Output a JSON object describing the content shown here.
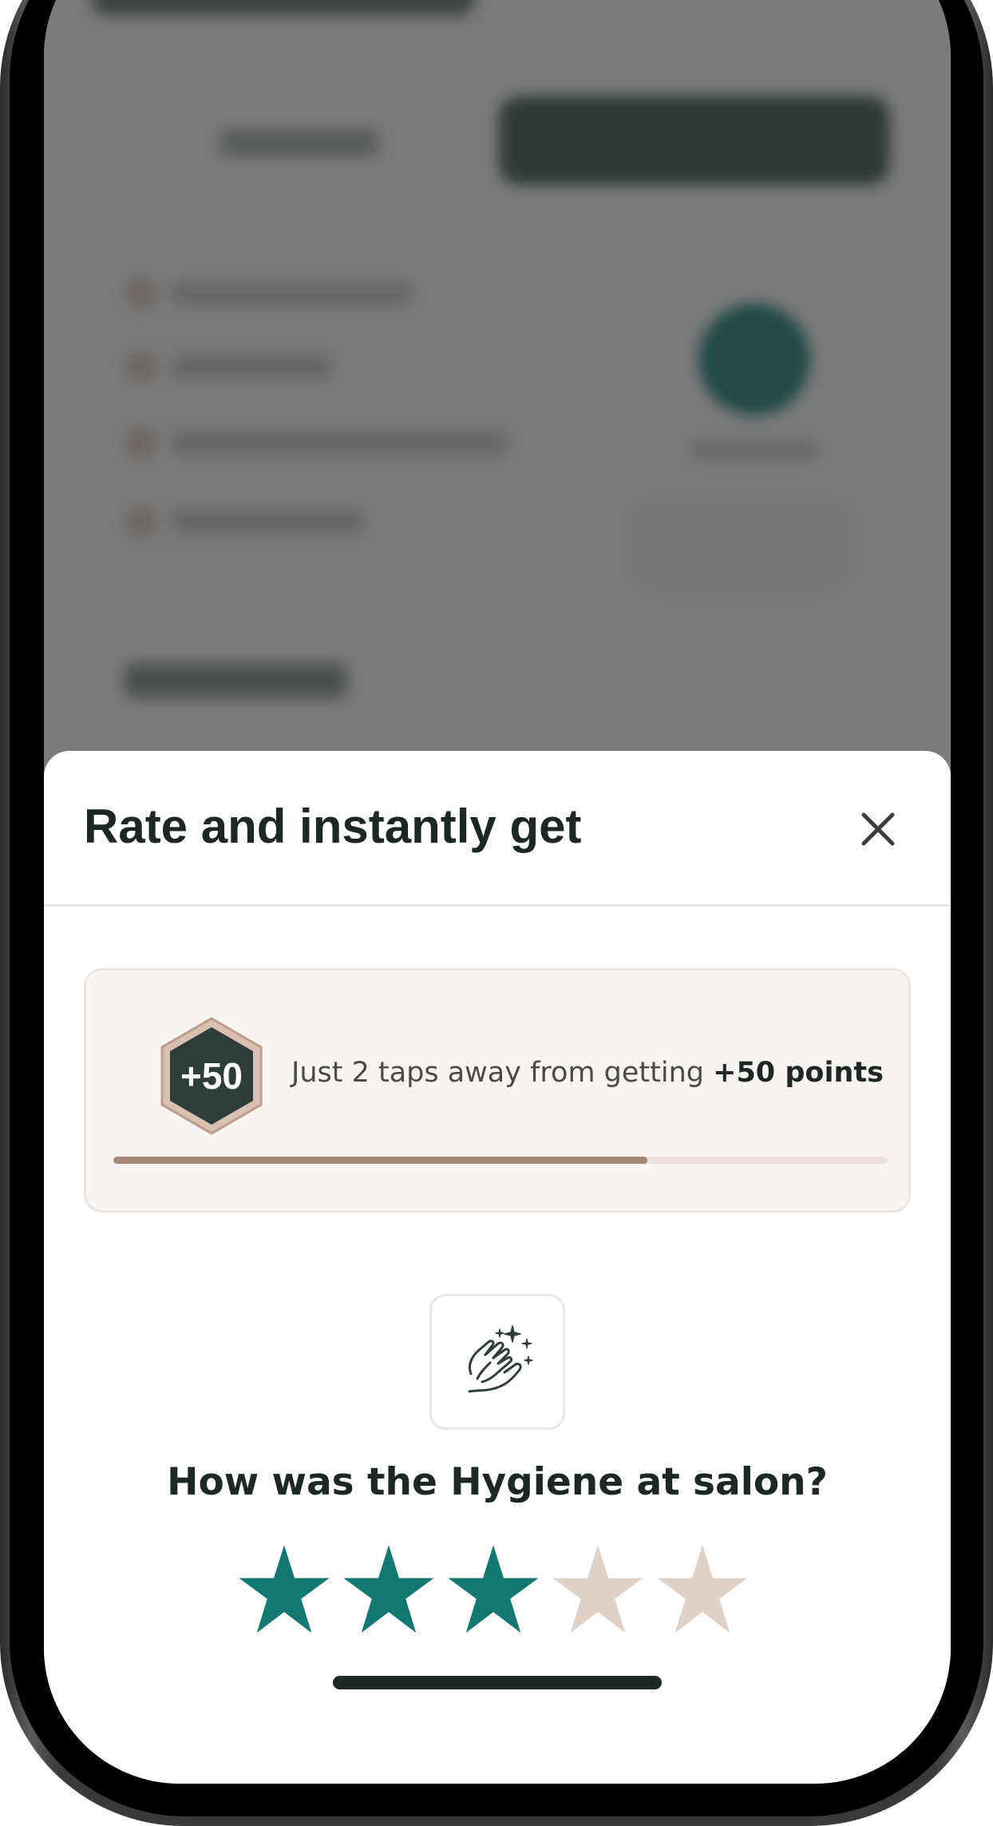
{
  "colors": {
    "accent_teal": "#147872",
    "star_inactive": "#e0d1c7",
    "badge_fill": "#2f3d3a",
    "badge_border": "#c9ab9c",
    "progress_fill": "#a58874",
    "progress_track": "#ecdedb",
    "title_text": "#1d2826"
  },
  "sheet": {
    "title": "Rate and instantly get",
    "close_icon": "close-x-icon"
  },
  "reward": {
    "badge_label": "+50",
    "text_prefix": "Just 2 taps away from getting ",
    "text_bold": "+50 points",
    "progress_fraction": 0.69
  },
  "question": {
    "icon": "hand-wash-sparkle-icon",
    "text": "How was the Hygiene at salon?"
  },
  "rating": {
    "max": 5,
    "value": 3
  }
}
